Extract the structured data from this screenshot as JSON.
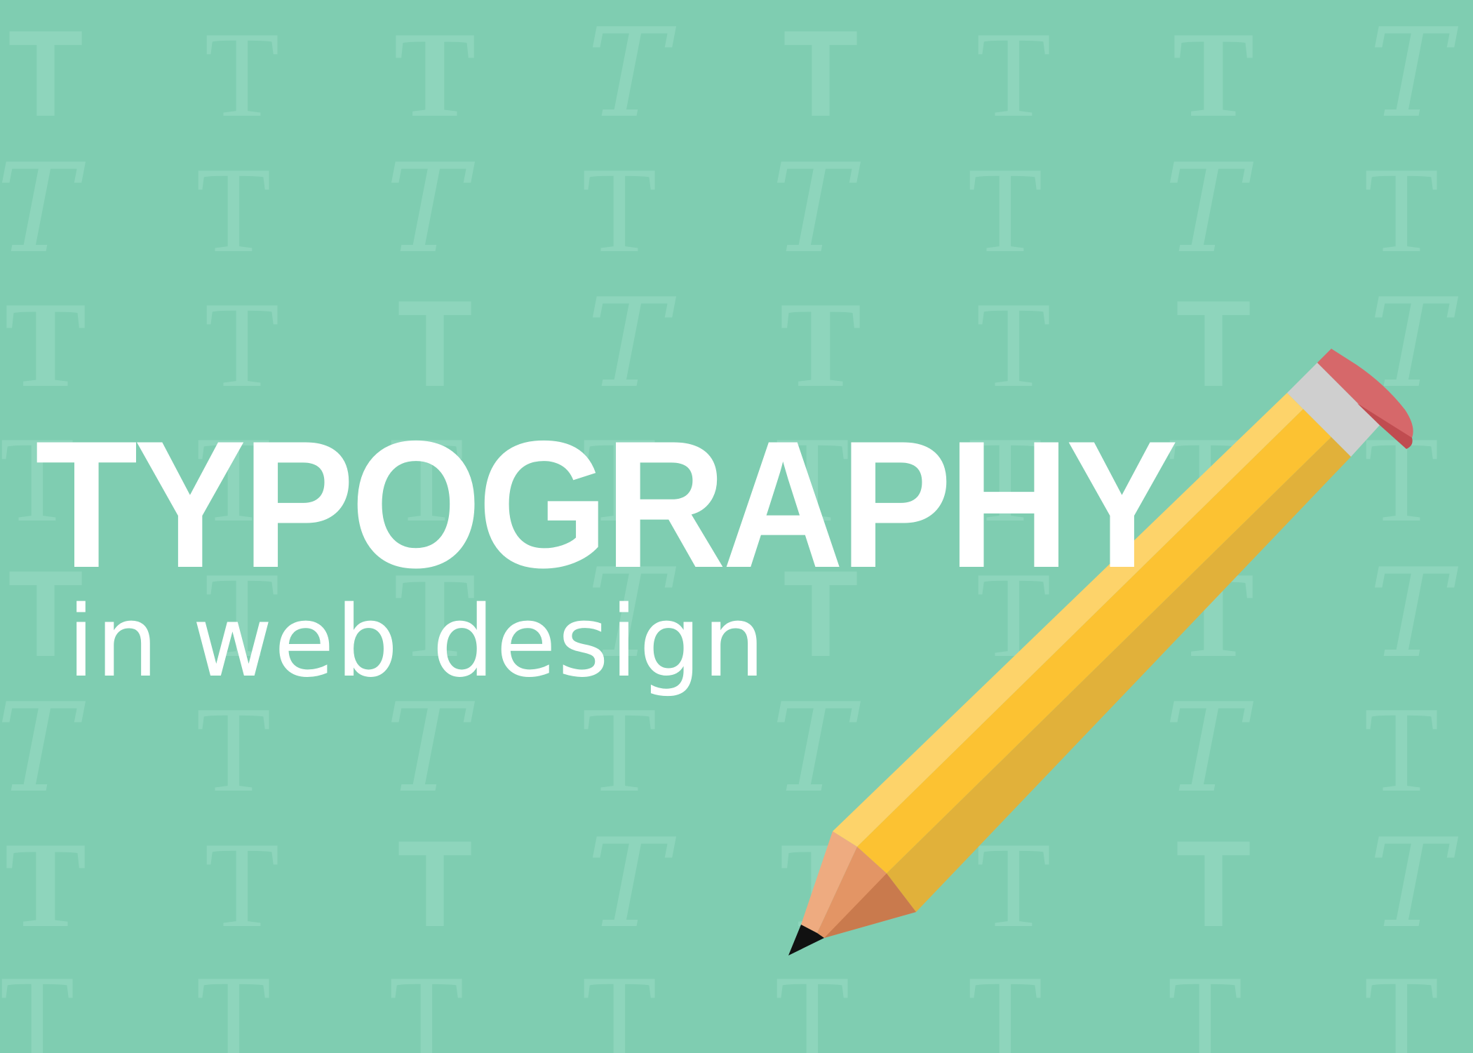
{
  "colors": {
    "background": "#7fcdb1",
    "pattern_glyph": "#8ed5bc",
    "heading": "#ffffff",
    "pencil_body": "#fcc232",
    "pencil_highlight": "#fdd36a",
    "pencil_shadow": "#e1b13a",
    "pencil_ferrule": "#cfcfcf",
    "eraser": "#d6686a",
    "wood": "#e39565",
    "graphite": "#111111"
  },
  "heading": {
    "title": "TYPOGRAPHY",
    "subtitle": "in web design"
  },
  "background_pattern": {
    "glyph": "T"
  },
  "illustration": {
    "icon": "pencil-icon"
  }
}
